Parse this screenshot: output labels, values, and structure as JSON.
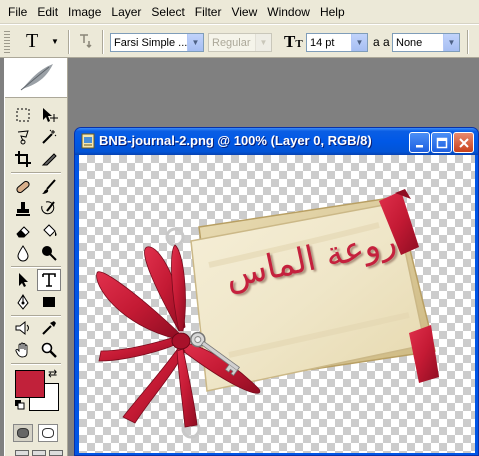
{
  "menubar": {
    "items": [
      "File",
      "Edit",
      "Image",
      "Layer",
      "Select",
      "Filter",
      "View",
      "Window",
      "Help"
    ]
  },
  "options": {
    "tool_glyph": "T",
    "font_family": "Farsi Simple ...",
    "font_style": "Regular",
    "font_size": "14 pt",
    "antialias_glyph": "a a",
    "antialias": "None",
    "size_glyph": "T"
  },
  "toolbox": {
    "active_tool": "type-tool",
    "foreground_color": "#c1213a",
    "background_color": "#ffffff"
  },
  "document": {
    "title": "BNB-journal-2.png @ 100% (Layer 0, RGB/8)",
    "artwork_text": "روعة الماس"
  },
  "colors": {
    "titlebar": "#0058e6",
    "ribbon": "#c41a34",
    "paper": "#efe6c8"
  }
}
